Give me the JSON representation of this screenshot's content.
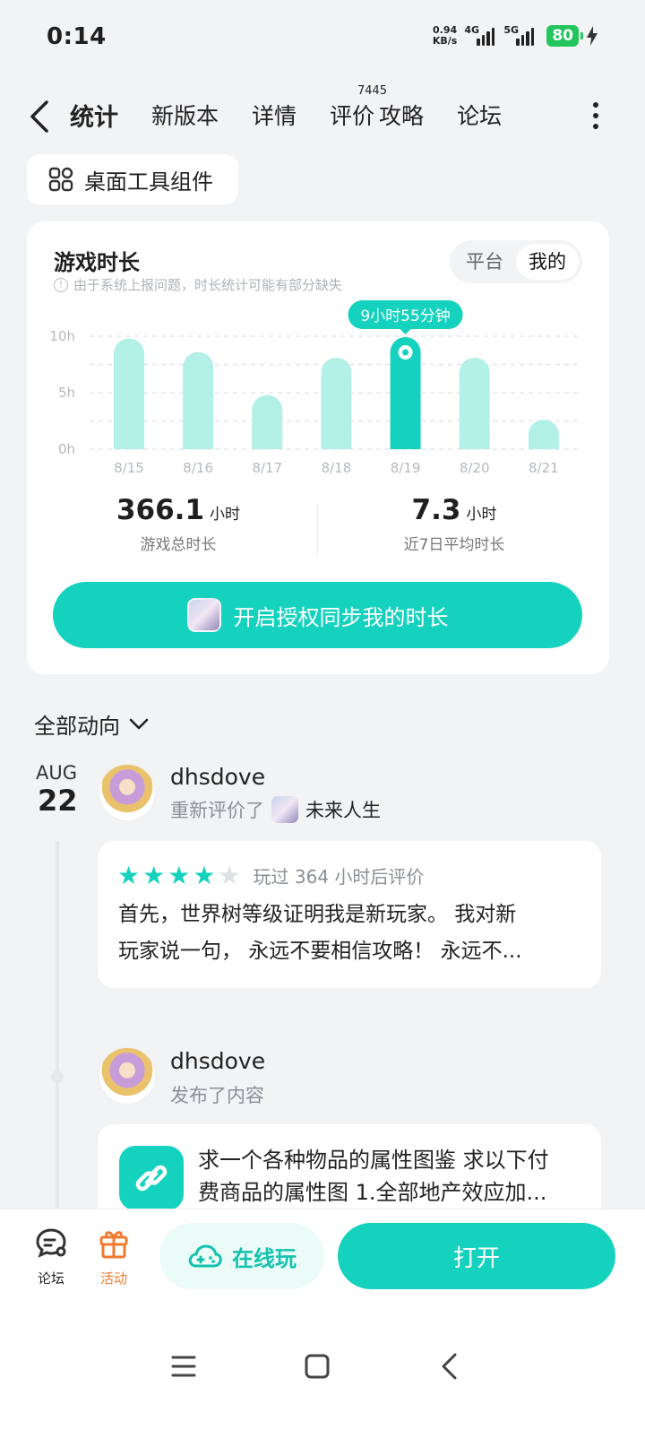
{
  "status_bar": {
    "time": "0:14",
    "net_speed_value": "0.94",
    "net_speed_unit": "KB/s",
    "sim1": "4G",
    "sim2": "5G",
    "battery": "80"
  },
  "nav": {
    "tabs": [
      {
        "label": "统计",
        "active": true
      },
      {
        "label": "新版本"
      },
      {
        "label": "详情"
      },
      {
        "label": "评价",
        "badge": "7445"
      },
      {
        "label": "攻略"
      },
      {
        "label": "论坛"
      }
    ]
  },
  "widget_chip": {
    "label": "桌面工具组件",
    "icon": "widgets-icon"
  },
  "stats_card": {
    "title": "游戏时长",
    "note": "由于系统上报问题，时长统计可能有部分缺失",
    "toggle": {
      "options": [
        "平台",
        "我的"
      ],
      "selected": "我的"
    },
    "tooltip": "9小时55分钟",
    "total": {
      "value": "366.1",
      "unit": "小时",
      "label": "游戏总时长"
    },
    "average": {
      "value": "7.3",
      "unit": "小时",
      "label": "近7日平均时长"
    },
    "sync_button": "开启授权同步我的时长",
    "colors": {
      "accent": "#14d2bd",
      "bar_light": "#b2f0e8"
    }
  },
  "chart_data": {
    "type": "bar",
    "categories": [
      "8/15",
      "8/16",
      "8/17",
      "8/18",
      "8/19",
      "8/20",
      "8/21"
    ],
    "values": [
      9.8,
      8.6,
      4.8,
      8.1,
      9.92,
      8.1,
      2.6
    ],
    "highlight_index": 4,
    "ylim": [
      0,
      10
    ],
    "yticks": [
      "0h",
      "5h",
      "10h"
    ],
    "grid": true
  },
  "feed": {
    "filter_label": "全部动向",
    "date": {
      "month": "AUG",
      "day": "22"
    },
    "items": [
      {
        "user": "dhsdove",
        "action": "重新评价了",
        "game": "未来人生",
        "rating": 4,
        "max_rating": 5,
        "meta": "玩过 364 小时后评价",
        "text_line1": "首先，世界树等级证明我是新玩家。 我对新",
        "text_line2": "玩家说一句， 永远不要相信攻略！ 永远不..."
      },
      {
        "user": "dhsdove",
        "action": "发布了内容",
        "text_line1": "求一个各种物品的属性图鉴 求以下付",
        "text_line2": "费商品的属性图 1.全部地产效应加..."
      }
    ]
  },
  "bottom_bar": {
    "forum": "论坛",
    "activity": "活动",
    "play_online": "在线玩",
    "open": "打开",
    "activity_color": "#f07a2e"
  }
}
